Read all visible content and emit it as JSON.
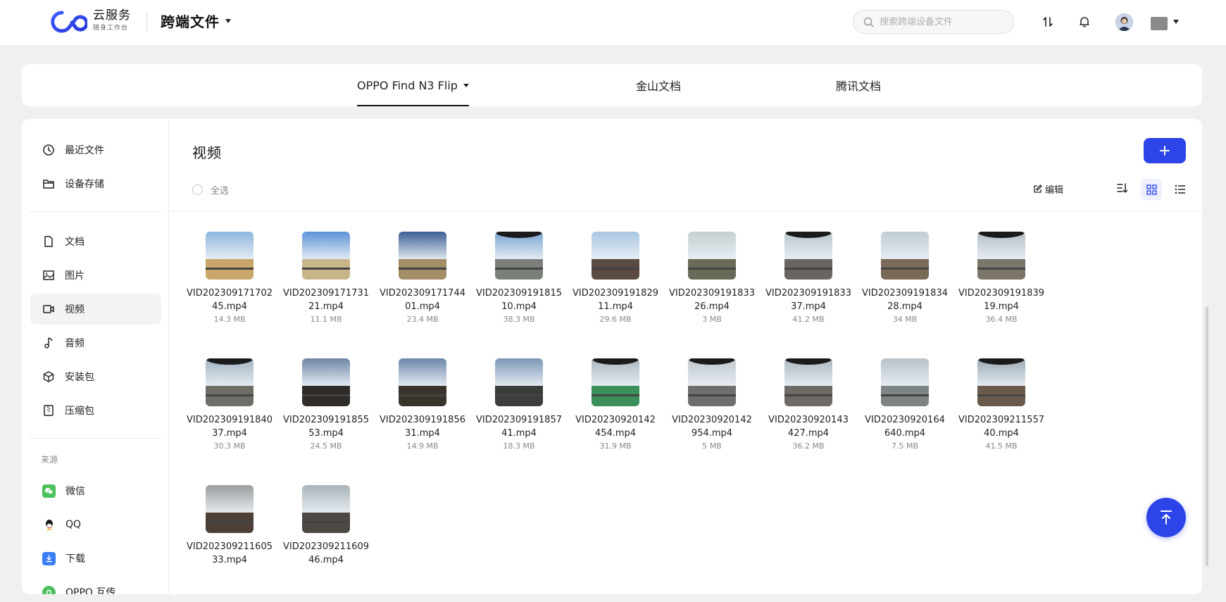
{
  "header": {
    "brand_name": "云服务",
    "brand_sub": "随身工作台",
    "app_title": "跨端文件",
    "search_placeholder": "搜索跨端设备文件"
  },
  "device_tabs": [
    {
      "label": "OPPO Find N3 Flip",
      "active": true
    },
    {
      "label": "金山文档",
      "active": false
    },
    {
      "label": "腾讯文档",
      "active": false
    }
  ],
  "sidebar": {
    "items": [
      {
        "label": "最近文件",
        "icon": "clock-icon"
      },
      {
        "label": "设备存储",
        "icon": "folder-icon"
      },
      {
        "label": "文档",
        "icon": "document-icon"
      },
      {
        "label": "图片",
        "icon": "image-icon"
      },
      {
        "label": "视频",
        "icon": "video-icon",
        "active": true
      },
      {
        "label": "音频",
        "icon": "music-icon"
      },
      {
        "label": "安装包",
        "icon": "package-icon"
      },
      {
        "label": "压缩包",
        "icon": "archive-icon"
      }
    ],
    "source_title": "来源",
    "sources": [
      {
        "label": "微信",
        "icon": "wechat-icon",
        "color": "#4cc05f"
      },
      {
        "label": "QQ",
        "icon": "qq-icon",
        "color": "#ffffff"
      },
      {
        "label": "下载",
        "icon": "download-icon",
        "color": "#3a7df5"
      },
      {
        "label": "OPPO 互传",
        "icon": "oppo-share-icon",
        "color": "#4cc05f"
      }
    ]
  },
  "content": {
    "title": "视频",
    "select_all": "全选",
    "edit_label": "编辑",
    "accent_color": "#2d45e8"
  },
  "files": [
    {
      "name_line1": "VID202309171702",
      "name_line2": "45.mp4",
      "size": "14.3 MB"
    },
    {
      "name_line1": "VID202309171731",
      "name_line2": "21.mp4",
      "size": "11.1 MB"
    },
    {
      "name_line1": "VID202309171744",
      "name_line2": "01.mp4",
      "size": "23.4 MB"
    },
    {
      "name_line1": "VID202309191815",
      "name_line2": "10.mp4",
      "size": "38.3 MB"
    },
    {
      "name_line1": "VID202309191829",
      "name_line2": "11.mp4",
      "size": "29.6 MB"
    },
    {
      "name_line1": "VID202309191833",
      "name_line2": "26.mp4",
      "size": "3 MB"
    },
    {
      "name_line1": "VID202309191833",
      "name_line2": "37.mp4",
      "size": "41.2 MB"
    },
    {
      "name_line1": "VID202309191834",
      "name_line2": "28.mp4",
      "size": "34 MB"
    },
    {
      "name_line1": "VID202309191839",
      "name_line2": "19.mp4",
      "size": "36.4 MB"
    },
    {
      "name_line1": "VID202309191840",
      "name_line2": "37.mp4",
      "size": "30.3 MB"
    },
    {
      "name_line1": "VID202309191855",
      "name_line2": "53.mp4",
      "size": "24.5 MB"
    },
    {
      "name_line1": "VID202309191856",
      "name_line2": "31.mp4",
      "size": "14.9 MB"
    },
    {
      "name_line1": "VID202309191857",
      "name_line2": "41.mp4",
      "size": "18.3 MB"
    },
    {
      "name_line1": "VID20230920142",
      "name_line2": "454.mp4",
      "size": "31.9 MB"
    },
    {
      "name_line1": "VID20230920142",
      "name_line2": "954.mp4",
      "size": "5 MB"
    },
    {
      "name_line1": "VID20230920143",
      "name_line2": "427.mp4",
      "size": "36.2 MB"
    },
    {
      "name_line1": "VID20230920164",
      "name_line2": "640.mp4",
      "size": "7.5 MB"
    },
    {
      "name_line1": "VID202309211557",
      "name_line2": "40.mp4",
      "size": "41.5 MB"
    },
    {
      "name_line1": "VID202309211605",
      "name_line2": "33.mp4",
      "size": ""
    },
    {
      "name_line1": "VID202309211609",
      "name_line2": "46.mp4",
      "size": ""
    }
  ]
}
